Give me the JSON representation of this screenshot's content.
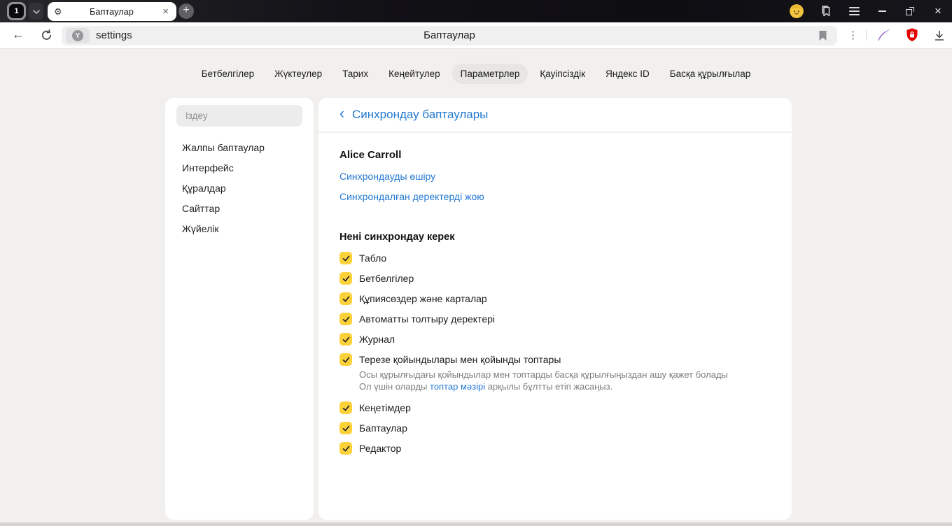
{
  "colors": {
    "accent_blue": "#2479d2",
    "checkbox_yellow": "#fcd23a",
    "shield_red": "#e20000",
    "feather_purple": "#a77fd6"
  },
  "icons": {
    "gear": "⚙",
    "close": "×",
    "plus": "+",
    "back_arrow": "←",
    "back_chevron": "‹",
    "kebab": "⋮",
    "protect_badge_letter": "Y"
  },
  "browser": {
    "tab_count": "1",
    "tab_title": "Баптаулар",
    "address_title": "Баптаулар",
    "url_text": "settings"
  },
  "nav": {
    "tabs": [
      {
        "label": "Бетбелгілер",
        "active": false
      },
      {
        "label": "Жүктеулер",
        "active": false
      },
      {
        "label": "Тарих",
        "active": false
      },
      {
        "label": "Кеңейтулер",
        "active": false
      },
      {
        "label": "Параметрлер",
        "active": true
      },
      {
        "label": "Қауіпсіздік",
        "active": false
      },
      {
        "label": "Яндекс ID",
        "active": false
      },
      {
        "label": "Басқа құрылғылар",
        "active": false
      }
    ]
  },
  "sidebar": {
    "search_placeholder": "Іздеу",
    "items": [
      "Жалпы баптаулар",
      "Интерфейс",
      "Құралдар",
      "Сайттар",
      "Жүйелік"
    ]
  },
  "main": {
    "back_title": "Синхрондау баптаулары",
    "account_name": "Alice Carroll",
    "account_links": [
      "Синхрондауды өшіру",
      "Синхрондалған деректерді жою"
    ],
    "sync": {
      "title": "Нені синхрондау керек",
      "items": [
        {
          "label": "Табло",
          "checked": true
        },
        {
          "label": "Бетбелгілер",
          "checked": true
        },
        {
          "label": "Құпиясөздер және карталар",
          "checked": true
        },
        {
          "label": "Автоматты толтыру деректері",
          "checked": true
        },
        {
          "label": "Журнал",
          "checked": true
        },
        {
          "label": "Терезе қойындылары мен қойынды топтары",
          "checked": true,
          "description": {
            "line1": "Осы құрылғыдағы қойындылар мен топтарды басқа құрылғыңыздан ашу қажет болады",
            "line2_before": "Ол үшін оларды ",
            "line2_link": "топтар мәзірі",
            "line2_after": " арқылы бұлтты етіп жасаңыз."
          }
        },
        {
          "label": "Кеңетімдер",
          "checked": true
        },
        {
          "label": "Баптаулар",
          "checked": true
        },
        {
          "label": "Редактор",
          "checked": true
        }
      ]
    }
  }
}
